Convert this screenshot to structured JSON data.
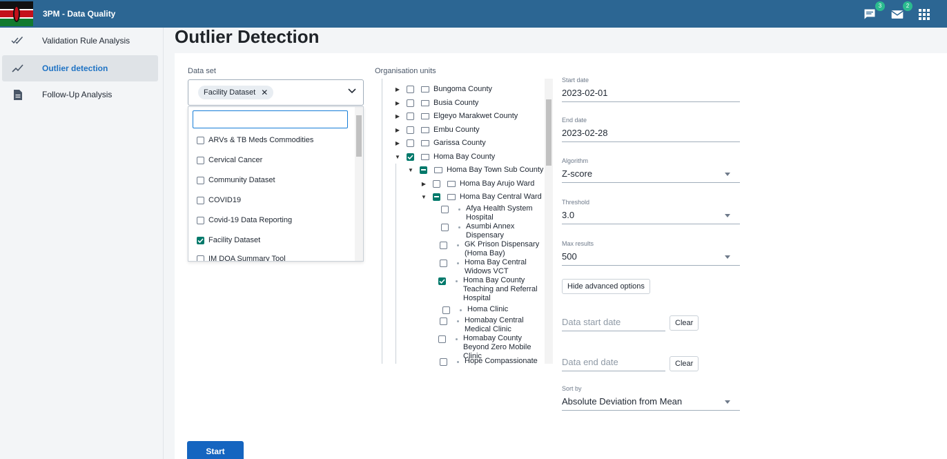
{
  "header": {
    "title": "3PM - Data Quality",
    "messages_count": "3",
    "email_count": "2",
    "colors": {
      "bar": "#2c6693",
      "badge": "#2bbb8f"
    }
  },
  "sidebar": {
    "items": [
      {
        "label": "Validation Rule Analysis",
        "icon": "double-check-icon",
        "active": false
      },
      {
        "label": "Outlier detection",
        "icon": "trend-line-icon",
        "active": true
      },
      {
        "label": "Follow-Up Analysis",
        "icon": "document-icon",
        "active": false
      }
    ]
  },
  "main": {
    "page_title": "Outlier Detection",
    "data_set": {
      "label": "Data set",
      "selected_chip": "Facility Dataset",
      "search_value": "",
      "options": [
        {
          "label": "ARVs & TB Meds Commodities",
          "checked": false
        },
        {
          "label": "Cervical Cancer",
          "checked": false
        },
        {
          "label": "Community Dataset",
          "checked": false
        },
        {
          "label": "COVID19",
          "checked": false
        },
        {
          "label": "Covid-19 Data Reporting",
          "checked": false
        },
        {
          "label": "Facility Dataset",
          "checked": true
        },
        {
          "label": "IM DQA Summary Tool",
          "checked": false
        }
      ]
    },
    "org_units": {
      "label": "Organisation units",
      "nodes": [
        {
          "label": "Bungoma County",
          "state": "unchecked",
          "expanded": false
        },
        {
          "label": "Busia County",
          "state": "unchecked",
          "expanded": false
        },
        {
          "label": "Elgeyo Marakwet County",
          "state": "unchecked",
          "expanded": false
        },
        {
          "label": "Embu County",
          "state": "unchecked",
          "expanded": false
        },
        {
          "label": "Garissa County",
          "state": "unchecked",
          "expanded": false
        },
        {
          "label": "Homa Bay County",
          "state": "checked",
          "expanded": true
        },
        {
          "label": "Homa Bay Town Sub County",
          "state": "partial",
          "expanded": true
        },
        {
          "label": "Homa Bay Arujo Ward",
          "state": "unchecked",
          "expanded": false
        },
        {
          "label": "Homa Bay Central Ward",
          "state": "partial",
          "expanded": true
        },
        {
          "label": "Afya Health System Hospital",
          "state": "unchecked",
          "leaf": true
        },
        {
          "label": "Asumbi Annex Dispensary",
          "state": "unchecked",
          "leaf": true
        },
        {
          "label": "GK Prison Dispensary (Homa Bay)",
          "state": "unchecked",
          "leaf": true
        },
        {
          "label": "Homa Bay Central Widows VCT",
          "state": "unchecked",
          "leaf": true
        },
        {
          "label": "Homa Bay County Teaching and Referral Hospital",
          "state": "checked",
          "leaf": true
        },
        {
          "label": "Homa Clinic",
          "state": "unchecked",
          "leaf": true
        },
        {
          "label": "Homabay Central Medical Clinic",
          "state": "unchecked",
          "leaf": true
        },
        {
          "label": "Homabay County Beyond Zero Mobile Clinic",
          "state": "unchecked",
          "leaf": true
        },
        {
          "label": "Hope Compassionate",
          "state": "unchecked",
          "leaf": true
        }
      ]
    },
    "form": {
      "start_date": {
        "label": "Start date",
        "value": "2023-02-01"
      },
      "end_date": {
        "label": "End date",
        "value": "2023-02-28"
      },
      "algorithm": {
        "label": "Algorithm",
        "value": "Z-score"
      },
      "threshold": {
        "label": "Threshold",
        "value": "3.0"
      },
      "max_results": {
        "label": "Max results",
        "value": "500"
      },
      "advanced_button": "Hide advanced options",
      "data_start_date": {
        "placeholder": "Data start date",
        "clear": "Clear"
      },
      "data_end_date": {
        "placeholder": "Data end date",
        "clear": "Clear"
      },
      "sort_by": {
        "label": "Sort by",
        "value": "Absolute Deviation from Mean"
      }
    },
    "start_button": "Start"
  }
}
